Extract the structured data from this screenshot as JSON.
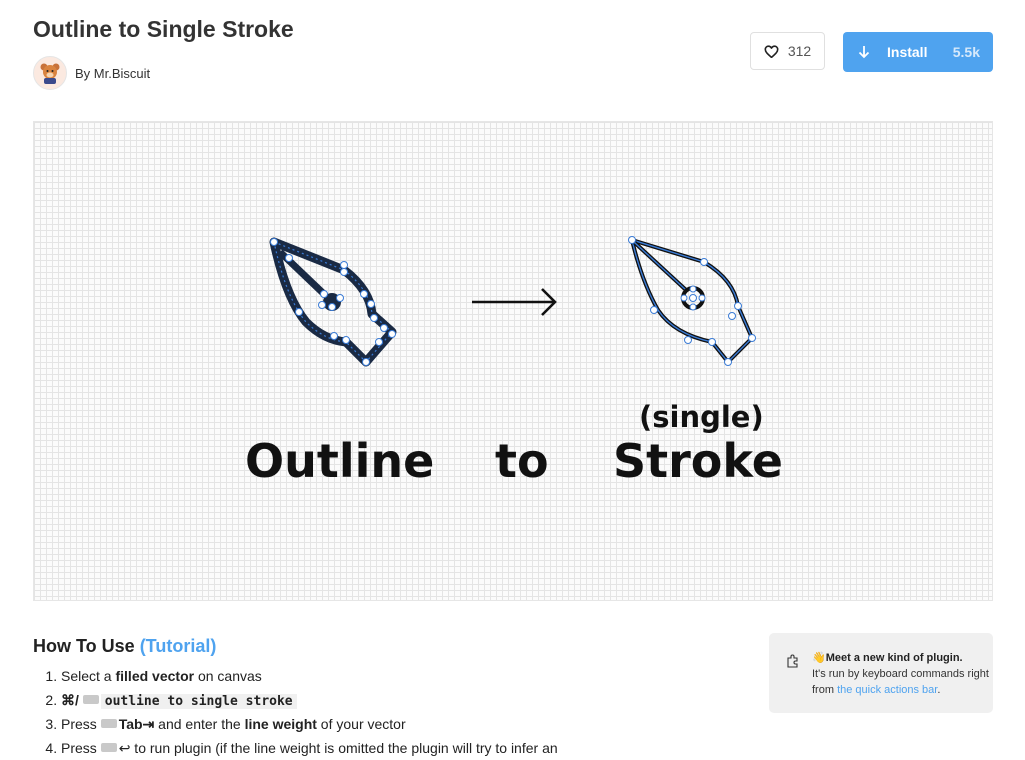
{
  "plugin": {
    "title": "Outline to Single Stroke",
    "author": "By Mr.Biscuit"
  },
  "actions": {
    "like_count": "312",
    "install_label": "Install",
    "install_count": "5.5k",
    "accent_color": "#4fa3ef"
  },
  "hero": {
    "word_outline": "Outline",
    "word_to": "to",
    "word_single": "(single)",
    "word_stroke": "Stroke"
  },
  "howto": {
    "heading": "How To Use",
    "tutorial_link": "(Tutorial)",
    "steps": [
      {
        "pre": "Select a ",
        "bold": "filled vector",
        "post": " on canvas"
      },
      {
        "shortcut": "⌘/",
        "code": "outline to single stroke"
      },
      {
        "pre": "Press ",
        "key": "Tab⇥",
        "mid": " and enter the ",
        "bold": "line weight",
        "post": " of your vector"
      },
      {
        "pre": "Press ",
        "key": "↩",
        "post": " to run plugin (if the line weight is omitted the plugin will try to infer an"
      }
    ]
  },
  "info_box": {
    "emoji": "👋",
    "headline": "Meet a new kind of plugin.",
    "body": "It's run by keyboard commands right from",
    "link": "the quick actions bar",
    "end": "."
  }
}
